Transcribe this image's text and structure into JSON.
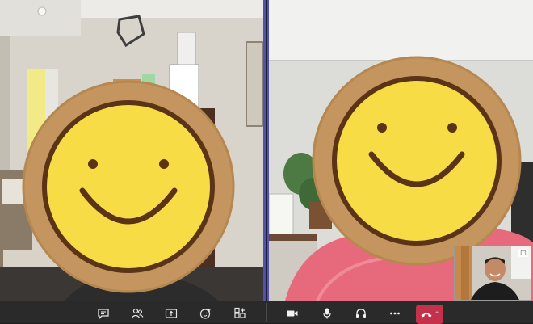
{
  "call": {
    "participants": [
      {
        "tile": "left",
        "face_overlay": "smiley-face"
      },
      {
        "tile": "right",
        "face_overlay": "smiley-face"
      }
    ],
    "self_view": {
      "present": true
    },
    "active_speaker_border_color": "#4f52b2"
  },
  "toolbar": {
    "left_buttons": [
      {
        "name": "chat",
        "icon": "chat-icon"
      },
      {
        "name": "people",
        "icon": "people-icon"
      },
      {
        "name": "share",
        "icon": "share-icon"
      },
      {
        "name": "reactions",
        "icon": "reactions-icon"
      },
      {
        "name": "apps",
        "icon": "apps-icon"
      }
    ],
    "right_buttons": [
      {
        "name": "camera",
        "icon": "camera-icon"
      },
      {
        "name": "mic",
        "icon": "mic-icon"
      },
      {
        "name": "audio",
        "icon": "headset-icon"
      },
      {
        "name": "more",
        "icon": "more-icon"
      }
    ],
    "leave": {
      "icon": "hang-up-icon",
      "color": "#c4314b"
    }
  }
}
